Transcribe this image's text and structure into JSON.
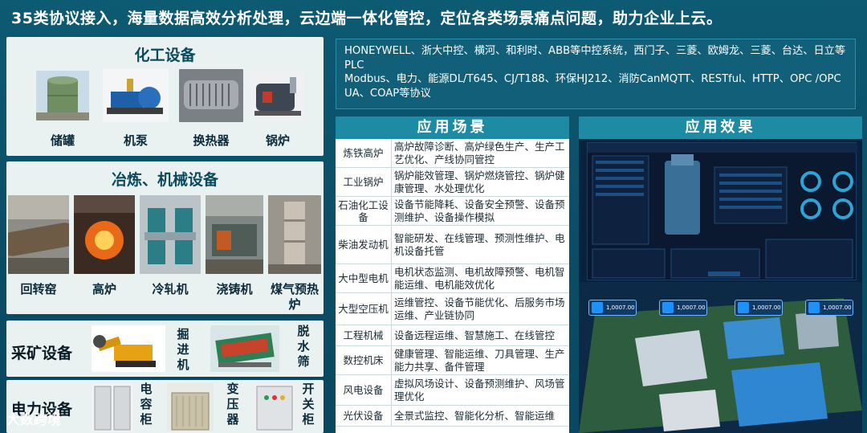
{
  "headline": "35类协议接入，海量数据高效分析处理，云边端一体化管控，定位各类场景痛点问题，助力企业上云。",
  "chemical": {
    "title": "化工设备",
    "items": [
      "储罐",
      "机泵",
      "换热器",
      "锅炉"
    ]
  },
  "metallurgy": {
    "title": "冶炼、机械设备",
    "items": [
      "回转窑",
      "高炉",
      "冷轧机",
      "浇铸机",
      "煤气预热炉"
    ]
  },
  "mining": {
    "title": "采矿设备",
    "items": [
      "掘进机",
      "脱水筛"
    ]
  },
  "power": {
    "title": "电力设备",
    "items": [
      "电容柜",
      "变压器",
      "开关柜"
    ]
  },
  "protocols": {
    "line1": "HONEYWELL、浙大中控、横河、和利时、ABB等中控系统，西门子、三菱、欧姆龙、三菱、台达、日立等PLC",
    "line2": "Modbus、电力、能源DL/T645、CJ/T188、环保HJ212、消防CanMQTT、RESTful、HTTP、OPC /OPC UA、COAP等协议"
  },
  "applications": {
    "title": "应用场景",
    "rows": [
      {
        "k": "炼铁高炉",
        "v": "高炉故障诊断、高炉绿色生产、生产工艺优化、产线协同管控"
      },
      {
        "k": "工业锅炉",
        "v": "锅炉能效管理、锅炉燃烧管控、锅炉健康管理、水处理优化"
      },
      {
        "k": "石油化工设备",
        "v": "设备节能降耗、设备安全预警、设备预测维护、设备操作模拟"
      },
      {
        "k": "柴油发动机",
        "v": "智能研发、在线管理、预测性维护、电机设备托管"
      },
      {
        "k": "大中型电机",
        "v": "电机状态监测、电机故障预警、电机智能运维、电机能效优化"
      },
      {
        "k": "大型空压机",
        "v": "运维管控、设备节能优化、后服务市场运维、产业链协同"
      },
      {
        "k": "工程机械",
        "v": "设备远程运维、智慧施工、在线管控"
      },
      {
        "k": "数控机床",
        "v": "健康管理、智能运维、刀具管理、生产能力共享、备件管理"
      },
      {
        "k": "风电设备",
        "v": "虚拟风场设计、设备预测维护、风场管理优化"
      },
      {
        "k": "光伏设备",
        "v": "全景式监控、智能化分析、智能运维"
      }
    ]
  },
  "effect": {
    "title": "应用效果",
    "cards": [
      "1,0007.00",
      "1,0007.00",
      "1,0007.00",
      "1,0007.00"
    ]
  },
  "watermark": "大数跨境"
}
